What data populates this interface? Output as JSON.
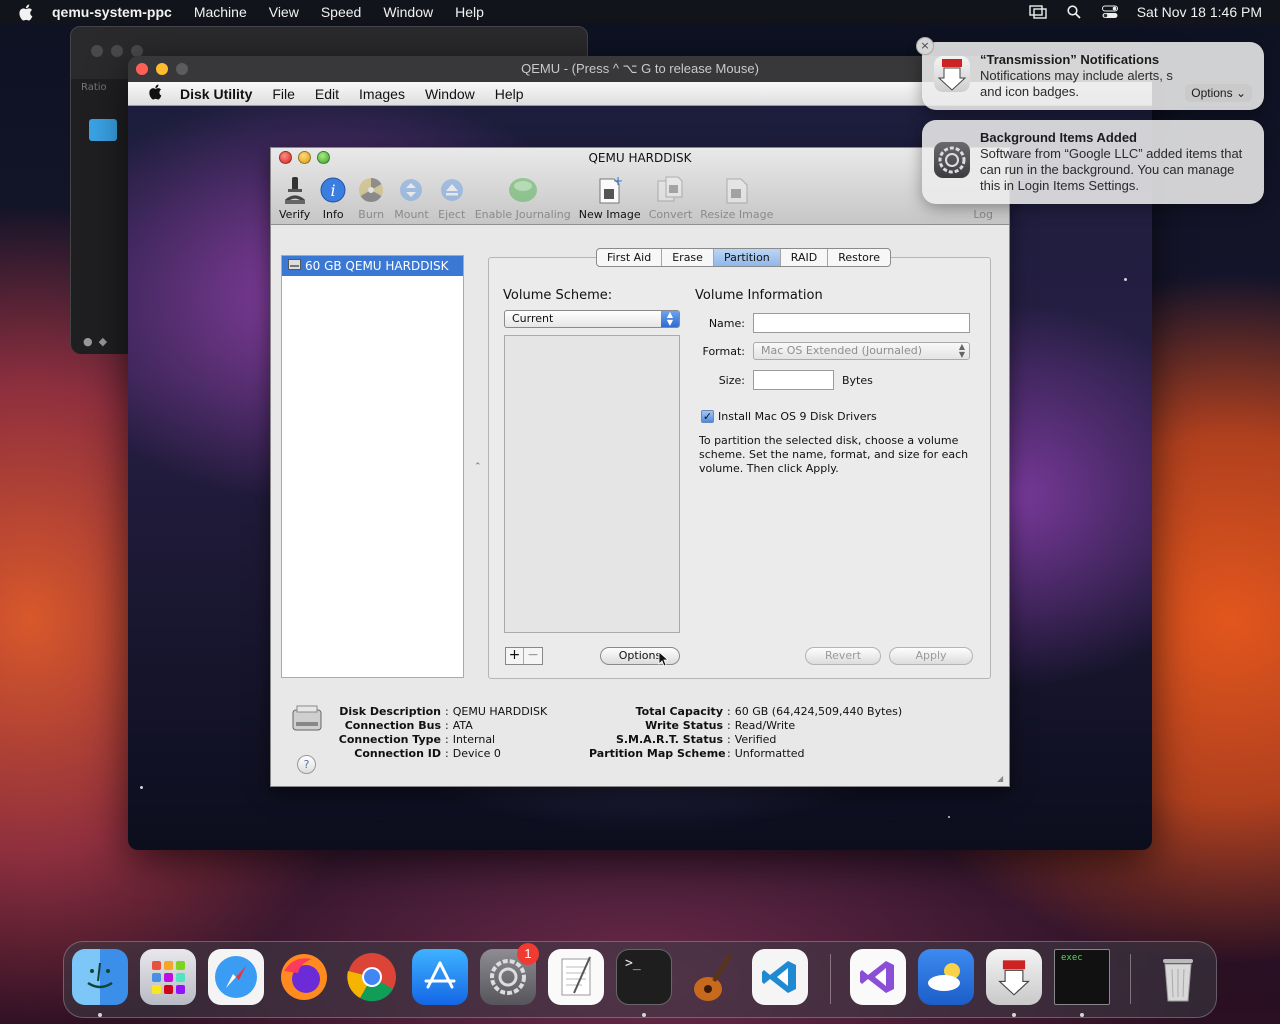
{
  "menubar": {
    "app": "qemu-system-ppc",
    "items": [
      "Machine",
      "View",
      "Speed",
      "Window",
      "Help"
    ],
    "clock": "Sat Nov 18  1:46 PM"
  },
  "utm_back": {
    "ratio": "Ratio"
  },
  "qemu": {
    "title": "QEMU - (Press  ^ ⌥ G  to release Mouse)",
    "guest_menu": {
      "app": "Disk Utility",
      "items": [
        "File",
        "Edit",
        "Images",
        "Window",
        "Help"
      ]
    }
  },
  "disk_utility": {
    "title": "QEMU HARDDISK",
    "toolbar": [
      {
        "label": "Verify",
        "icon": "microscope-icon",
        "enabled": true
      },
      {
        "label": "Info",
        "icon": "info-icon",
        "enabled": true
      },
      {
        "label": "Burn",
        "icon": "burn-icon",
        "enabled": false
      },
      {
        "label": "Mount",
        "icon": "mount-icon",
        "enabled": false
      },
      {
        "label": "Eject",
        "icon": "eject-icon",
        "enabled": false
      },
      {
        "label": "Enable Journaling",
        "icon": "journal-icon",
        "enabled": false
      },
      {
        "label": "New Image",
        "icon": "new-image-icon",
        "enabled": true
      },
      {
        "label": "Convert",
        "icon": "convert-icon",
        "enabled": false
      },
      {
        "label": "Resize Image",
        "icon": "resize-image-icon",
        "enabled": false
      }
    ],
    "log": "Log",
    "disk_item": "60 GB QEMU HARDDISK",
    "tabs": [
      "First Aid",
      "Erase",
      "Partition",
      "RAID",
      "Restore"
    ],
    "active_tab": "Partition",
    "volume_scheme_label": "Volume Scheme:",
    "volume_scheme_value": "Current",
    "volume_info_label": "Volume Information",
    "name_label": "Name:",
    "name_value": "",
    "format_label": "Format:",
    "format_value": "Mac OS Extended (Journaled)",
    "size_label": "Size:",
    "size_value": "",
    "bytes_label": "Bytes",
    "checkbox_label": "Install Mac OS 9 Disk Drivers",
    "checkbox_checked": true,
    "help_text": "To partition the selected disk, choose a volume scheme. Set the name, format, and size for each volume. Then click Apply.",
    "plus": "+",
    "minus": "−",
    "options": "Options",
    "revert": "Revert",
    "apply": "Apply",
    "help_button": "?",
    "info_left": [
      {
        "k": "Disk Description",
        "v": "QEMU HARDDISK"
      },
      {
        "k": "Connection Bus",
        "v": "ATA"
      },
      {
        "k": "Connection Type",
        "v": "Internal"
      },
      {
        "k": "Connection ID",
        "v": "Device 0"
      }
    ],
    "info_right": [
      {
        "k": "Total Capacity",
        "v": "60 GB (64,424,509,440 Bytes)"
      },
      {
        "k": "Write Status",
        "v": "Read/Write"
      },
      {
        "k": "S.M.A.R.T. Status",
        "v": "Verified"
      },
      {
        "k": "Partition Map Scheme",
        "v": "Unformatted"
      }
    ]
  },
  "notifications": [
    {
      "title": "“Transmission” Notifications",
      "body": "Notifications may include alerts, s  and icon badges.",
      "options": "Options",
      "icon": "transmission-icon"
    },
    {
      "title": "Background Items Added",
      "body": "Software from “Google LLC” added items that can run in the background. You can manage this in Login Items Settings.",
      "icon": "gear-icon"
    }
  ],
  "notif_close": "×",
  "dock": {
    "badge": "1",
    "terminal_glyph": ">_",
    "exec_label": "exec",
    "apps": [
      "finder",
      "launchpad",
      "safari",
      "firefox",
      "chrome",
      "app-store",
      "system-settings",
      "textedit",
      "terminal",
      "garageband",
      "vscode",
      "visual-studio",
      "weather",
      "transmission",
      "exec-console",
      "trash"
    ]
  },
  "colors": {
    "accent": "#3b78d4",
    "tab_active": "#8fb7ea",
    "badge": "#ef3b32"
  }
}
